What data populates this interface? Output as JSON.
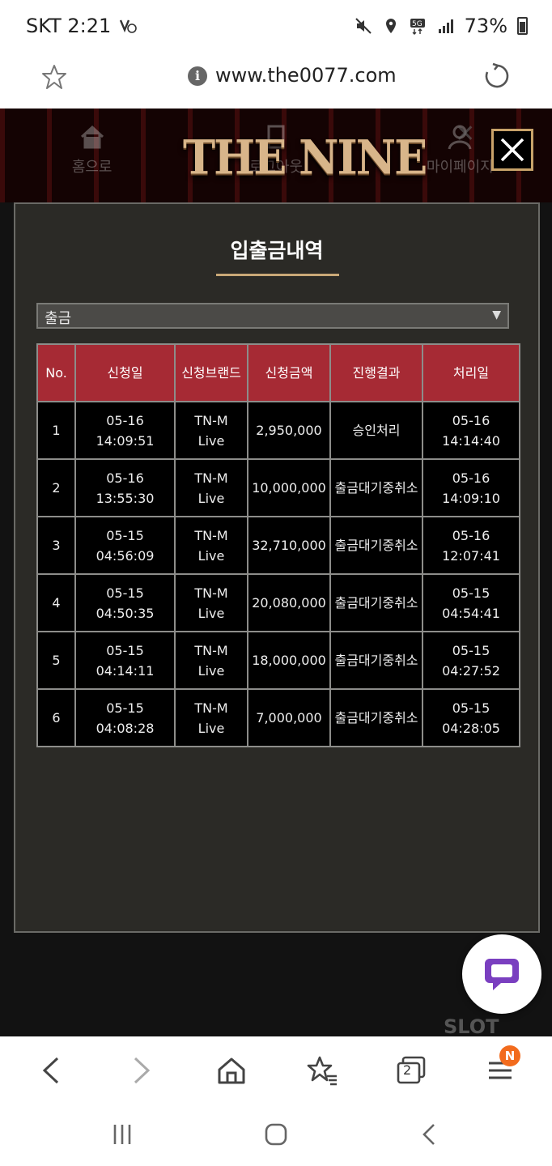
{
  "status_bar": {
    "carrier_time": "SKT 2:21",
    "battery": "73%"
  },
  "url_bar": {
    "url": "www.the0077.com"
  },
  "site": {
    "logo": "THE NINE",
    "nav": [
      {
        "label": "홈으로"
      },
      {
        "label": "로그아웃"
      },
      {
        "label": "마이페이지"
      }
    ]
  },
  "modal": {
    "title": "입출금내역",
    "select_value": "출금",
    "headers": [
      "No.",
      "신청일",
      "신청브랜드",
      "신청금액",
      "진행결과",
      "처리일"
    ],
    "rows": [
      {
        "no": "1",
        "date": "05-16",
        "time": "14:09:51",
        "brand1": "TN-M",
        "brand2": "Live",
        "amount": "2,950,000",
        "result": "승인처리",
        "pdate": "05-16",
        "ptime": "14:14:40"
      },
      {
        "no": "2",
        "date": "05-16",
        "time": "13:55:30",
        "brand1": "TN-M",
        "brand2": "Live",
        "amount": "10,000,000",
        "result": "출금대기중취소",
        "pdate": "05-16",
        "ptime": "14:09:10"
      },
      {
        "no": "3",
        "date": "05-15",
        "time": "04:56:09",
        "brand1": "TN-M",
        "brand2": "Live",
        "amount": "32,710,000",
        "result": "출금대기중취소",
        "pdate": "05-16",
        "ptime": "12:07:41"
      },
      {
        "no": "4",
        "date": "05-15",
        "time": "04:50:35",
        "brand1": "TN-M",
        "brand2": "Live",
        "amount": "20,080,000",
        "result": "출금대기중취소",
        "pdate": "05-15",
        "ptime": "04:54:41"
      },
      {
        "no": "5",
        "date": "05-15",
        "time": "04:14:11",
        "brand1": "TN-M",
        "brand2": "Live",
        "amount": "18,000,000",
        "result": "출금대기중취소",
        "pdate": "05-15",
        "ptime": "04:27:52"
      },
      {
        "no": "6",
        "date": "05-15",
        "time": "04:08:28",
        "brand1": "TN-M",
        "brand2": "Live",
        "amount": "7,000,000",
        "result": "출금대기중취소",
        "pdate": "05-15",
        "ptime": "04:28:05"
      }
    ]
  },
  "background": {
    "slot_text": "SLOT"
  },
  "toolbar": {
    "tabs_count": "2",
    "menu_badge": "N"
  },
  "colors": {
    "accent_gold": "#c9a877",
    "header_red": "#a62a34",
    "chat_purple": "#7a3fc0",
    "badge_orange": "#f26b1d"
  },
  "icons": [
    "star-icon",
    "info-icon",
    "reload-icon",
    "close-icon",
    "chat-icon",
    "back-icon",
    "forward-icon",
    "home-icon",
    "bookmarks-icon",
    "tabs-icon",
    "menu-icon"
  ]
}
